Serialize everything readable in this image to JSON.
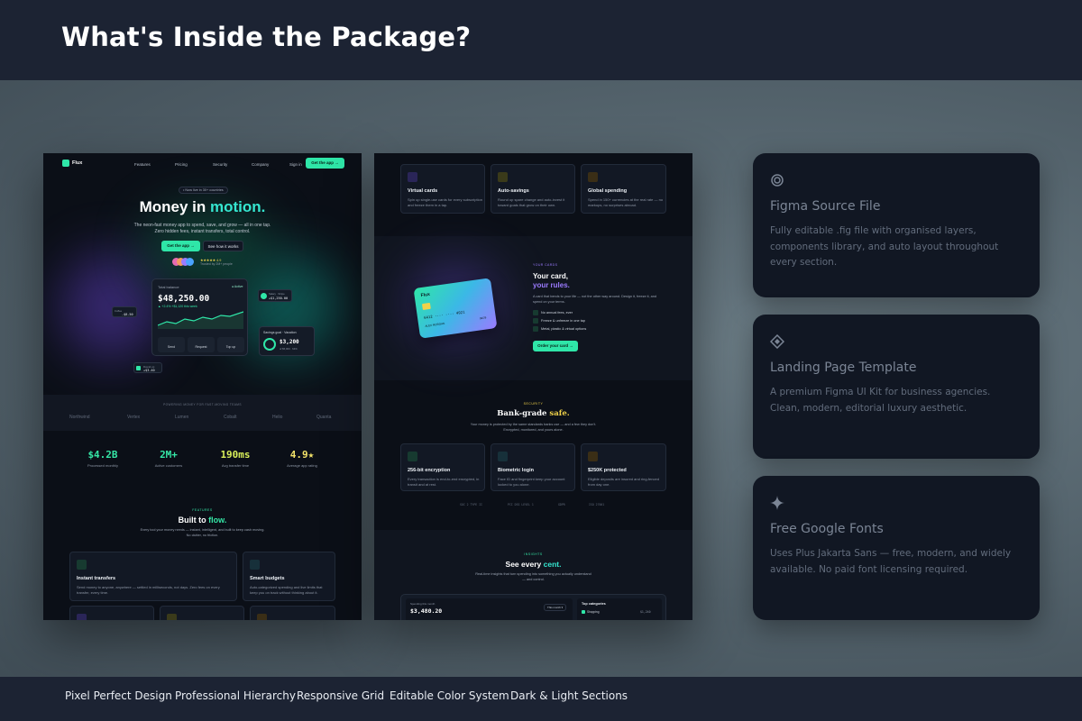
{
  "header": {
    "title": "What's Inside the Package?"
  },
  "screen1": {
    "brand": "Flux",
    "nav": [
      "Features",
      "Pricing",
      "Security",
      "Company"
    ],
    "signin": "Sign in",
    "cta": "Get the app →",
    "badge": "• Now live in 30+ countries",
    "hero_a": "Money in ",
    "hero_b": "motion.",
    "sub1": "The neon-fast money app to spend, save, and grow — all in one tap.",
    "sub2": "Zero hidden fees, instant transfers, total control.",
    "btn_primary": "Get the app →",
    "btn_secondary": "See how it works",
    "rating": "★★★★★ 4.9",
    "trusted": "Trusted by 2M+ people",
    "balance_label": "Total balance",
    "balance_status": "● Active",
    "balance": "$48,250.00",
    "balance_delta": "▲ +2.4%  +$1,120 this week",
    "actions": [
      "Send",
      "Request",
      "Top up"
    ],
    "float1_label": "Coffee",
    "float1_value": "-$8.50",
    "float2_label": "Salary · Stripe",
    "float2_value": "+$1,250.00",
    "float3_label": "Round-up",
    "float3_value": "+$3.40",
    "goal_label": "Savings goal · Vacation",
    "goal_value": "$3,200",
    "goal_sub": "of $5,000 · 64%",
    "powering": "POWERING MONEY FOR FAST-MOVING TEAMS",
    "logos": [
      "Northwind",
      "Vertex",
      "Lumen",
      "Cobalt",
      "Helio",
      "Quanta"
    ],
    "stats": [
      {
        "value": "$4.2B",
        "label": "Processed monthly",
        "color": "#35e6a6"
      },
      {
        "value": "2M+",
        "label": "Active customers",
        "color": "#35e6a6"
      },
      {
        "value": "190ms",
        "label": "Avg transfer time",
        "color": "#d8ef5a"
      },
      {
        "value": "4.9★",
        "label": "Average app rating",
        "color": "#f3e36a"
      }
    ],
    "features_kicker": "FEATURES",
    "features_a": "Built to ",
    "features_b": "flow.",
    "features_sub1": "Every tool your money needs — instant, intelligent, and built to keep cash moving.",
    "features_sub2": "No clutter, no friction.",
    "cards": [
      {
        "title": "Instant transfers",
        "desc": "Send money to anyone, anywhere — settled in milliseconds, not days. Zero fees on every transfer, every time."
      },
      {
        "title": "Smart budgets",
        "desc": "Auto-categorized spending and live limits that keep you on track without thinking about it."
      }
    ]
  },
  "screen2": {
    "cards_top": [
      {
        "title": "Virtual cards",
        "desc": "Spin up single-use cards for every subscription and freeze them in a tap."
      },
      {
        "title": "Auto-savings",
        "desc": "Round up spare change and auto-invest it toward goals that grow on their own."
      },
      {
        "title": "Global spending",
        "desc": "Spend in 150+ currencies at the real rate — no markups, no surprises abroad."
      }
    ],
    "card_kicker": "YOUR CARDS",
    "card_title_a": "Your card,",
    "card_title_b": "your rules.",
    "card_desc": "A card that bends to your life — not the other way around. Design it, freeze it, and spend on your terms.",
    "card_checks": [
      "No annual fees, ever",
      "Freeze & unfreeze in one tap",
      "Metal, plastic & virtual options"
    ],
    "card_cta": "Order your card →",
    "cc_brand": "Flux",
    "cc_number": "6412 ···· ···· 4921",
    "cc_name": "ALEX MORGAN",
    "cc_exp": "09/29",
    "security_kicker": "SECURITY",
    "security_a": "Bank-grade ",
    "security_b": "safe.",
    "security_sub1": "Your money is protected by the same standards banks use — and a few they don't.",
    "security_sub2": "Encrypted, monitored, and yours alone.",
    "sec_cards": [
      {
        "title": "256-bit encryption",
        "desc": "Every transaction is end-to-end encrypted, in transit and at rest."
      },
      {
        "title": "Biometric login",
        "desc": "Face ID and fingerprint keep your account locked to you alone."
      },
      {
        "title": "$250K protected",
        "desc": "Eligible deposits are insured and ring-fenced from day one."
      }
    ],
    "certs": [
      "SOC 2 TYPE II",
      "PCI DSS LEVEL 1",
      "GDPR",
      "ISO 27001"
    ],
    "insights_kicker": "INSIGHTS",
    "insights_a": "See every ",
    "insights_b": "cent.",
    "insights_sub1": "Real-time insights that turn spending into something you actually understand",
    "insights_sub2": "— and control.",
    "spending_label": "Spending this month",
    "spending_value": "$3,480.20",
    "period": "This month ▾",
    "top_categories": "Top categories",
    "cat_name": "Shopping",
    "cat_value": "$1,240"
  },
  "info_cards": [
    {
      "title": "Figma Source File",
      "desc": "Fully editable .fig file with organised layers, components library, and auto layout throughout every section.",
      "icon": "circle-ring-icon"
    },
    {
      "title": "Landing Page Template",
      "desc": "A premium Figma UI Kit for business agencies. Clean, modern, editorial luxury aesthetic.",
      "icon": "diamond-icon"
    },
    {
      "title": "Free Google Fonts",
      "desc": "Uses Plus Jakarta Sans — free, modern, and widely available. No paid font licensing required.",
      "icon": "sparkle-icon"
    }
  ],
  "footer": {
    "features": [
      "Pixel Perfect Design",
      "Professional Hierarchy",
      "Responsive Grid",
      "Editable Color System",
      "Dark & Light Sections"
    ]
  },
  "colors": {
    "accent": "#2fe6a8",
    "purple": "#9b7bff",
    "yellow": "#f0d24a",
    "bg": "#1c2333"
  }
}
